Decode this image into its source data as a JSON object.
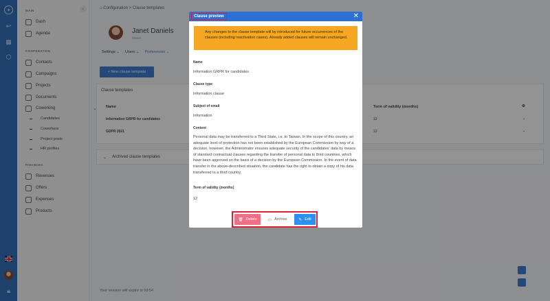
{
  "sidebar": {
    "sections": [
      {
        "title": "MAIN",
        "items": [
          "Dash",
          "Agenda"
        ]
      },
      {
        "title": "COOPERATION",
        "items": [
          "Contacts",
          "Campaigns",
          "Projects",
          "Documents",
          "Coworking"
        ]
      },
      {
        "title": "FINANCES",
        "items": [
          "Revenues",
          "Offers",
          "Expenses",
          "Products"
        ]
      }
    ],
    "coworking_sub": [
      "Candidates",
      "Coworkers",
      "Project posts",
      "HR profiles"
    ]
  },
  "breadcrumb": {
    "part1": "Configuration",
    "separator": ">",
    "part2": "Clause templates"
  },
  "profile": {
    "name": "Janet Daniels",
    "role": "Owner"
  },
  "nav_tabs": [
    "Settings ⌄",
    "Users ⌄",
    "Preferences ⌄"
  ],
  "new_button": "+ New clause template",
  "templates_card": {
    "title": "Clause templates",
    "col_name": "Name",
    "col_term": "Term of validity (months)",
    "rows": [
      {
        "name": "Information GRPR for candidates",
        "term": "12"
      },
      {
        "name": "GDPR 2021",
        "term": "12"
      }
    ]
  },
  "archived_title": "Archived clause templates",
  "session_text": "Your session will expire in 59:54",
  "modal": {
    "title": "Clause preview",
    "close": "✕",
    "alert": "Any changes to the clause template will by introduced for future occurrences of the clauses (including reactivation cases). Already added clauses will remain unchanged.",
    "fields": {
      "name_label": "Name",
      "name_value": "Information GRPR for candidates",
      "type_label": "Clause type",
      "type_value": "Information clause",
      "subject_label": "Subject of email",
      "subject_value": "Information",
      "content_label": "Content",
      "content_value": "Personal data may be transferred to a Third State, i.e. to Taiwan. In the scope of this country, an adequate level of protection has not been established by the European Commission by way of a decision, however, the Administrator ensures adequate security of the candidates' data by means of standard contractual clauses regarding the transfer of personal data to third countries, which have been approved on the basis of a decision by the European Commission. In the event of data transfer in the above-described situation, the candidate has the right to obtain a copy of his data transferred to a third country.",
      "term_label": "Term of validity (months)",
      "term_value": "12"
    },
    "buttons": {
      "delete": "Delete",
      "archive": "Archive",
      "edit": "Edit"
    }
  },
  "colors": {
    "primary": "#2d6fd2",
    "alert": "#f5a623",
    "danger": "#f06e86",
    "highlight": "#e0202f"
  }
}
